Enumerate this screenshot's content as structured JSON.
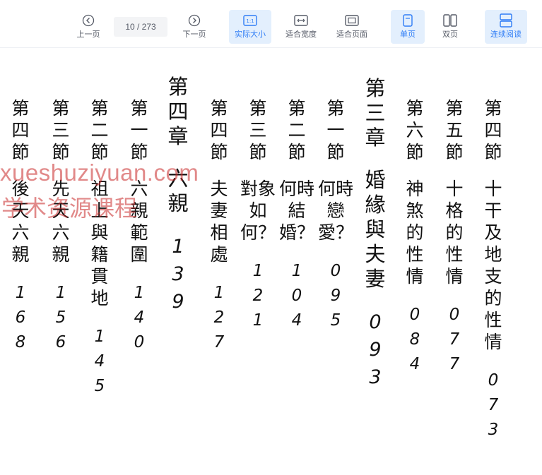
{
  "toolbar": {
    "prev_label": "上一页",
    "page_indicator": "10 / 273",
    "next_label": "下一页",
    "actual_size_label": "实际大小",
    "fit_width_label": "适合宽度",
    "fit_page_label": "适合页面",
    "single_label": "单页",
    "double_label": "双页",
    "continuous_label": "连续阅读",
    "accent_color": "#2f7df6"
  },
  "page": {
    "columns": [
      {
        "title": "第四節",
        "text": "十干及地支的性情",
        "page": "073"
      },
      {
        "title": "第五節",
        "text": "十格的性情",
        "page": "077"
      },
      {
        "title": "第六節",
        "text": "神煞的性情",
        "page": "084"
      },
      {
        "title": "第三章",
        "text": "婚緣與夫妻",
        "page": "093"
      },
      {
        "title": "第一節",
        "text": "何時戀愛？",
        "page": "095"
      },
      {
        "title": "第二節",
        "text": "何時結婚？",
        "page": "104"
      },
      {
        "title": "第三節",
        "text": "對象如何？",
        "page": "121"
      },
      {
        "title": "第四節",
        "text": "夫妻相處",
        "page": "127"
      },
      {
        "title": "第四章",
        "text": "六親",
        "page": "139"
      },
      {
        "title": "第一節",
        "text": "六親範圍",
        "page": "140"
      },
      {
        "title": "第二節",
        "text": "祖上與籍貫地",
        "page": "145"
      },
      {
        "title": "第三節",
        "text": "先天六親",
        "page": "156"
      },
      {
        "title": "第四節",
        "text": "後天六親",
        "page": "168"
      }
    ]
  },
  "watermark": {
    "line1": "xueshuziyuan.com",
    "line2": "学术资源课程"
  }
}
